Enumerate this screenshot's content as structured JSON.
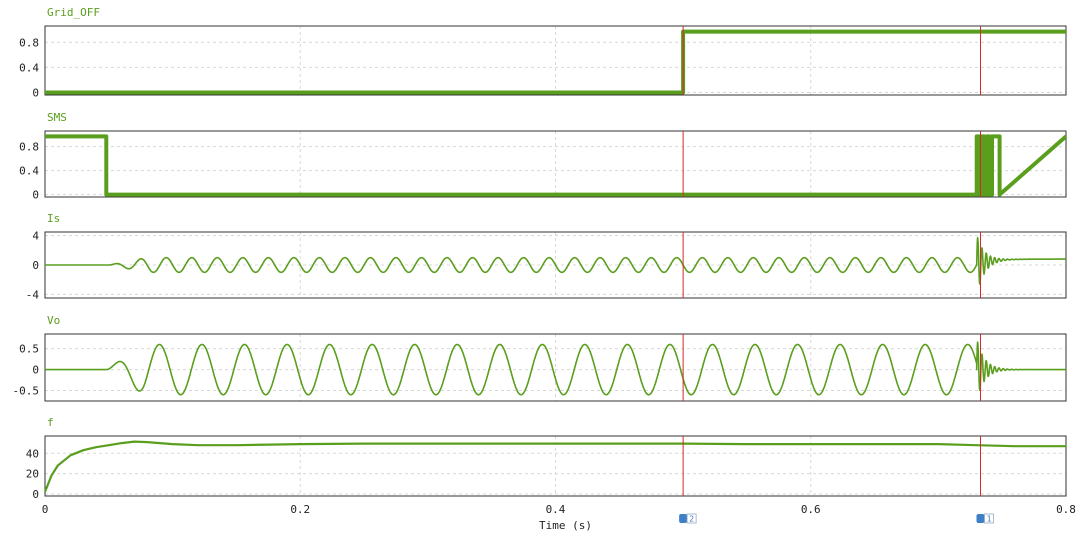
{
  "chart_data": [
    {
      "type": "line",
      "title": "Grid_OFF",
      "yticks": [
        "0.8",
        "0.4",
        "0"
      ],
      "ylim": [
        -0.04,
        1.06
      ],
      "series": [
        {
          "name": "Grid_OFF",
          "color": "#5a9e1e",
          "x": [
            0,
            0.5,
            0.5,
            0.8
          ],
          "values": [
            0,
            0,
            0.97,
            0.97
          ]
        }
      ]
    },
    {
      "type": "line",
      "title": "SMS",
      "yticks": [
        "0.8",
        "0.4",
        "0"
      ],
      "ylim": [
        -0.04,
        1.06
      ],
      "series": [
        {
          "name": "SMS",
          "color": "#5a9e1e",
          "x": [
            0,
            0.048,
            0.048,
            0.73,
            0.73,
            0.732,
            0.732,
            0.734,
            0.734,
            0.736,
            0.736,
            0.738,
            0.738,
            0.74,
            0.74,
            0.742,
            0.742,
            0.748,
            0.748,
            0.8
          ],
          "values": [
            0.97,
            0.97,
            0,
            0,
            0.97,
            0.97,
            0,
            0,
            0.97,
            0.97,
            0,
            0,
            0.97,
            0.97,
            0,
            0,
            0.97,
            0.97,
            0,
            0.97
          ]
        }
      ]
    },
    {
      "type": "line",
      "title": "Is",
      "yticks": [
        "4",
        "0",
        "-4"
      ],
      "ylim": [
        -4.5,
        4.5
      ],
      "series": [
        {
          "name": "Is",
          "color": "#5a9e1e",
          "description": "AC current: ~1 A sinusoid at ~50 Hz from 0.05 s, spike to -4.5 at 0.048 s, transient oscillation near 0.73 s decaying to ~0.8",
          "segments": [
            {
              "x": [
                0,
                0.048
              ],
              "amplitude": 0,
              "offset": 0
            },
            {
              "x": [
                0.05,
                0.73
              ],
              "amplitude": 1.0,
              "freq_hz": 50,
              "offset": 0
            },
            {
              "x": [
                0.73,
                0.8
              ],
              "peak": 4.2,
              "decay_to": 0.8
            }
          ]
        }
      ]
    },
    {
      "type": "line",
      "title": "Vo",
      "yticks": [
        "0.5",
        "0",
        "-0.5"
      ],
      "ylim": [
        -0.75,
        0.85
      ],
      "series": [
        {
          "name": "Vo",
          "color": "#5a9e1e",
          "description": "Output voltage: ~0.6 amplitude sinusoid at ~30 Hz from 0.05 s, transient near 0.73 s decaying to 0",
          "segments": [
            {
              "x": [
                0,
                0.048
              ],
              "amplitude": 0,
              "offset": 0
            },
            {
              "x": [
                0.048,
                0.73
              ],
              "amplitude": 0.6,
              "freq_hz": 30,
              "offset": 0
            },
            {
              "x": [
                0.73,
                0.8
              ],
              "peak": 0.75,
              "decay_to": 0
            }
          ]
        }
      ]
    },
    {
      "type": "line",
      "title": "f",
      "yticks": [
        "40",
        "20",
        "0"
      ],
      "ylim": [
        -2,
        57
      ],
      "series": [
        {
          "name": "f",
          "color": "#5a9e1e",
          "x": [
            0,
            0.005,
            0.01,
            0.02,
            0.03,
            0.04,
            0.05,
            0.06,
            0.07,
            0.08,
            0.09,
            0.1,
            0.12,
            0.15,
            0.2,
            0.25,
            0.3,
            0.4,
            0.5,
            0.55,
            0.6,
            0.7,
            0.73,
            0.76,
            0.8
          ],
          "values": [
            2,
            18,
            28,
            38,
            43,
            46,
            48,
            50,
            51.5,
            51,
            50,
            49,
            48,
            48,
            49,
            49.5,
            49.5,
            49.5,
            49.5,
            49,
            49,
            49,
            48,
            47,
            47
          ]
        }
      ]
    }
  ],
  "xaxis": {
    "label": "Time (s)",
    "ticks": [
      {
        "v": 0,
        "t": "0"
      },
      {
        "v": 0.2,
        "t": "0.2"
      },
      {
        "v": 0.4,
        "t": "0.4"
      },
      {
        "v": 0.6,
        "t": "0.6"
      },
      {
        "v": 0.8,
        "t": "0.8"
      }
    ],
    "xlim": [
      0,
      0.8
    ]
  },
  "markers": [
    {
      "id": "2",
      "x": 0.5,
      "color": "#d42a2a"
    },
    {
      "id": "1",
      "x": 0.733,
      "color": "#d42a2a"
    }
  ],
  "colors": {
    "trace": "#5a9e1e",
    "title": "#5a9e1e",
    "cursor": "#d42a2a",
    "frame": "#333333",
    "grid": "#d8d8d8"
  }
}
